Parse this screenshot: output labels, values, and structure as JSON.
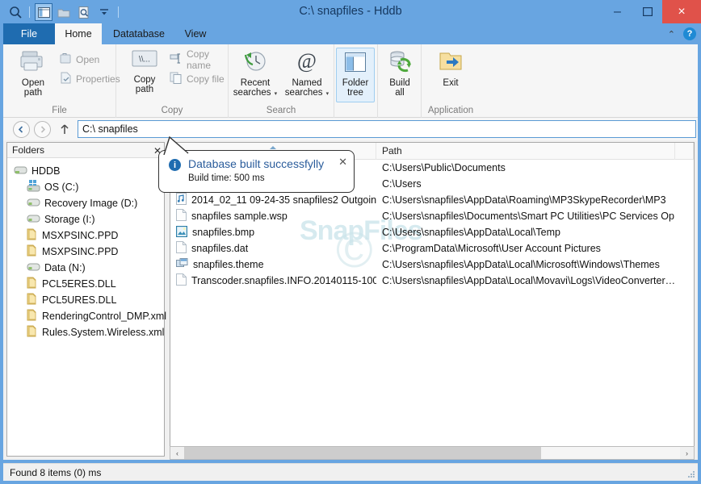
{
  "window": {
    "title": "C:\\ snapfiles - Hddb",
    "minimize": "–",
    "maximize": "☐",
    "close": "×",
    "accent_color": "#68a5e1",
    "close_color": "#e0524a"
  },
  "quick_access": {
    "items": [
      {
        "name": "search-icon",
        "glyph": "⌕"
      },
      {
        "name": "folder-tree-toggle-icon",
        "glyph": "panes"
      },
      {
        "name": "open-folder-icon",
        "glyph": "folder"
      },
      {
        "name": "find-file-icon",
        "glyph": "findfile"
      },
      {
        "name": "customize-qat-icon",
        "glyph": "▾"
      }
    ]
  },
  "ribbon": {
    "tabs": [
      {
        "label": "File",
        "id": "file",
        "selected": false,
        "is_file_menu": true
      },
      {
        "label": "Home",
        "id": "home",
        "selected": true
      },
      {
        "label": "Datatabase",
        "id": "datatabase",
        "selected": false
      },
      {
        "label": "View",
        "id": "view",
        "selected": false
      }
    ],
    "collapse_glyph": "⌃",
    "help_glyph": "?",
    "groups": [
      {
        "label": "File",
        "big_buttons": [
          {
            "label": "Open\npath",
            "line1": "Open",
            "line2": "path",
            "icon": "printer-folder-icon"
          }
        ],
        "small_buttons": [
          {
            "label": "Open",
            "icon": "open-icon",
            "disabled": true
          },
          {
            "label": "Properties",
            "icon": "properties-icon",
            "disabled": true
          }
        ]
      },
      {
        "label": "Copy",
        "big_buttons": [
          {
            "line1": "Copy",
            "line2": "path",
            "icon": "unc-path-icon"
          }
        ],
        "small_buttons": [
          {
            "label": "Copy name",
            "icon": "copy-name-icon",
            "disabled": true
          },
          {
            "label": "Copy file",
            "icon": "copy-file-icon",
            "disabled": true
          }
        ]
      },
      {
        "label": "Search",
        "big_buttons": [
          {
            "line1": "Recent",
            "line2": "searches",
            "icon": "recent-searches-icon",
            "has_caret": true
          },
          {
            "line1": "Named",
            "line2": "searches",
            "icon": "named-searches-icon",
            "has_caret": true
          }
        ],
        "small_buttons": []
      },
      {
        "label": "",
        "big_buttons": [
          {
            "line1": "Folder",
            "line2": "tree",
            "icon": "folder-tree-icon",
            "boxed": true
          }
        ],
        "small_buttons": []
      },
      {
        "label": "",
        "big_buttons": [
          {
            "line1": "Build",
            "line2": "all",
            "icon": "build-all-icon"
          }
        ],
        "small_buttons": []
      },
      {
        "label": "Application",
        "big_buttons": [
          {
            "line1": "Exit",
            "line2": "",
            "icon": "exit-icon"
          }
        ],
        "small_buttons": []
      }
    ]
  },
  "address_bar": {
    "back_glyph": "←",
    "forward_glyph": "→",
    "up_glyph": "↑",
    "value": "C:\\ snapfiles",
    "placeholder": "Path"
  },
  "folders_pane": {
    "header": "Folders",
    "close_glyph": "✕",
    "tree": [
      {
        "label": "HDDB",
        "icon": "drive-hddb-icon",
        "level": 0
      },
      {
        "label": "OS (C:)",
        "icon": "windows-drive-icon",
        "level": 1
      },
      {
        "label": "Recovery Image (D:)",
        "icon": "drive-icon",
        "level": 1
      },
      {
        "label": "Storage (I:)",
        "icon": "drive-icon",
        "level": 1
      },
      {
        "label": "MSXPSINC.PPD",
        "icon": "folder-icon",
        "level": 1
      },
      {
        "label": "MSXPSINC.PPD",
        "icon": "folder-icon",
        "level": 1
      },
      {
        "label": "Data (N:)",
        "icon": "drive-icon",
        "level": 1
      },
      {
        "label": "PCL5ERES.DLL",
        "icon": "folder-icon",
        "level": 1
      },
      {
        "label": "PCL5URES.DLL",
        "icon": "folder-icon",
        "level": 1
      },
      {
        "label": "RenderingControl_DMP.xml",
        "icon": "folder-icon",
        "level": 1
      },
      {
        "label": "Rules.System.Wireless.xml",
        "icon": "folder-icon",
        "level": 1
      }
    ]
  },
  "file_list": {
    "columns": [
      {
        "label": "",
        "id": "name",
        "sorted": true
      },
      {
        "label": "Path",
        "id": "path"
      },
      {
        "label": "",
        "id": "extra"
      }
    ],
    "rows": [
      {
        "name": "",
        "path": "C:\\Users\\Public\\Documents",
        "icon": ""
      },
      {
        "name": "",
        "path": "C:\\Users",
        "icon": ""
      },
      {
        "name": "2014_02_11 09-24-35 snapfiles2 Outgoin…",
        "path": "C:\\Users\\snapfiles\\AppData\\Roaming\\MP3SkypeRecorder\\MP3",
        "icon": "audio-file-icon"
      },
      {
        "name": "snapfiles sample.wsp",
        "path": "C:\\Users\\snapfiles\\Documents\\Smart PC Utilities\\PC Services Op…",
        "icon": "generic-file-icon"
      },
      {
        "name": "snapfiles.bmp",
        "path": "C:\\Users\\snapfiles\\AppData\\Local\\Temp",
        "icon": "image-file-icon"
      },
      {
        "name": "snapfiles.dat",
        "path": "C:\\ProgramData\\Microsoft\\User Account Pictures",
        "icon": "generic-file-icon"
      },
      {
        "name": "snapfiles.theme",
        "path": "C:\\Users\\snapfiles\\AppData\\Local\\Microsoft\\Windows\\Themes",
        "icon": "theme-file-icon"
      },
      {
        "name": "Transcoder.snapfiles.INFO.20140115-100…",
        "path": "C:\\Users\\snapfiles\\AppData\\Local\\Movavi\\Logs\\VideoConverter…",
        "icon": "generic-file-icon"
      }
    ],
    "watermark": "SnapFiles",
    "watermark_mark": "©",
    "hscroll": {
      "left_glyph": "‹",
      "right_glyph": "›"
    }
  },
  "notification": {
    "title": "Database built successfylly",
    "subtitle": "Build time: 500 ms",
    "icon": "info-icon",
    "icon_glyph": "i",
    "close_glyph": "✕"
  },
  "status_bar": {
    "text": "Found 8 items (0) ms"
  }
}
